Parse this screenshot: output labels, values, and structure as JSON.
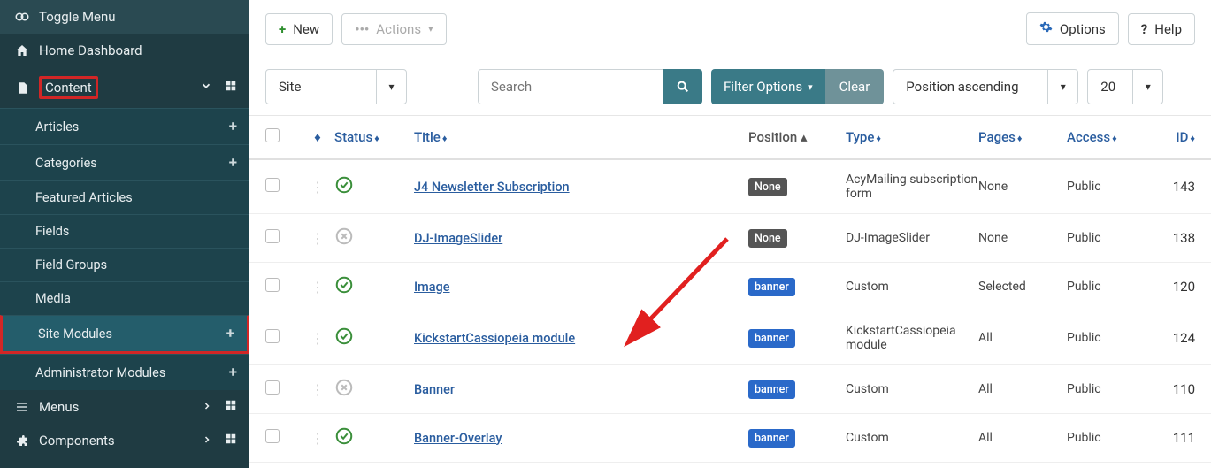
{
  "sidebar": {
    "toggle": "Toggle Menu",
    "home": "Home Dashboard",
    "content": "Content",
    "articles": "Articles",
    "categories": "Categories",
    "featured": "Featured Articles",
    "fields": "Fields",
    "field_groups": "Field Groups",
    "media": "Media",
    "site_modules": "Site Modules",
    "admin_modules": "Administrator Modules",
    "menus": "Menus",
    "components": "Components"
  },
  "toolbar": {
    "new": "New",
    "actions": "Actions",
    "options": "Options",
    "help": "Help"
  },
  "filters": {
    "client": "Site",
    "search_placeholder": "Search",
    "filter_options": "Filter Options",
    "clear": "Clear",
    "sort": "Position ascending",
    "limit": "20"
  },
  "table": {
    "headers": {
      "status": "Status",
      "title": "Title",
      "position": "Position",
      "type": "Type",
      "pages": "Pages",
      "access": "Access",
      "id": "ID"
    },
    "rows": [
      {
        "enabled": true,
        "title": "J4 Newsletter Subscription",
        "position_badge": "None",
        "position_class": "badge-none",
        "type": "AcyMailing subscription form",
        "pages": "None",
        "access": "Public",
        "id": "143"
      },
      {
        "enabled": false,
        "title": "DJ-ImageSlider",
        "position_badge": "None",
        "position_class": "badge-none",
        "type": "DJ-ImageSlider",
        "pages": "None",
        "access": "Public",
        "id": "138"
      },
      {
        "enabled": true,
        "title": "Image",
        "position_badge": "banner",
        "position_class": "badge-banner",
        "type": "Custom",
        "pages": "Selected",
        "access": "Public",
        "id": "120"
      },
      {
        "enabled": true,
        "title": "KickstartCassiopeia module",
        "position_badge": "banner",
        "position_class": "badge-banner",
        "type": "KickstartCassiopeia module",
        "pages": "All",
        "access": "Public",
        "id": "124"
      },
      {
        "enabled": false,
        "title": "Banner",
        "position_badge": "banner",
        "position_class": "badge-banner",
        "type": "Custom",
        "pages": "All",
        "access": "Public",
        "id": "110"
      },
      {
        "enabled": true,
        "title": "Banner-Overlay",
        "position_badge": "banner",
        "position_class": "badge-banner",
        "type": "Custom",
        "pages": "All",
        "access": "Public",
        "id": "111"
      }
    ]
  }
}
